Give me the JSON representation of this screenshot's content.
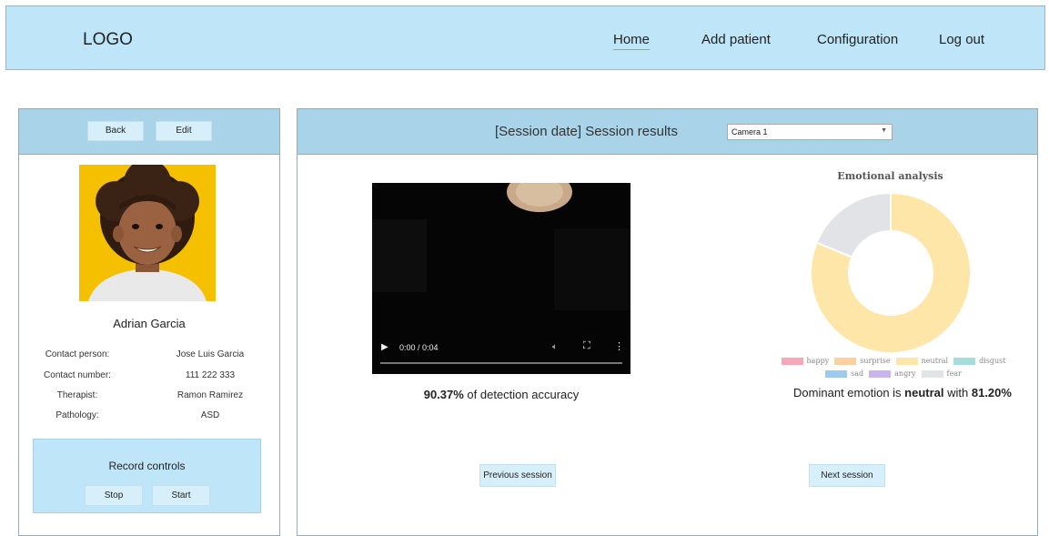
{
  "header": {
    "logo": "LOGO",
    "nav": [
      {
        "label": "Home",
        "active": true
      },
      {
        "label": "Add patient"
      },
      {
        "label": "Configuration"
      },
      {
        "label": "Log out"
      }
    ]
  },
  "patient_panel": {
    "back_label": "Back",
    "edit_label": "Edit",
    "name": "Adrian Garcia",
    "fields": [
      {
        "label": "Contact person:",
        "value": "Jose Luis Garcia"
      },
      {
        "label": "Contact number:",
        "value": "111 222 333"
      },
      {
        "label": "Therapist:",
        "value": "Ramon Ramirez"
      },
      {
        "label": "Pathology:",
        "value": "ASD"
      }
    ],
    "record_controls": {
      "title": "Record controls",
      "stop_label": "Stop",
      "start_label": "Start"
    }
  },
  "session": {
    "title": "[Session date] Session results",
    "camera_selected": "Camera 1",
    "video_time": "0:00 / 0:04",
    "accuracy_value": "90.37%",
    "accuracy_text": " of detection accuracy",
    "dominant_prefix": "Dominant emotion is ",
    "dominant_emotion": "neutral",
    "dominant_mid": " with ",
    "dominant_value": "81.20%",
    "previous_label": "Previous session",
    "next_label": "Next session"
  },
  "chart_data": {
    "type": "pie",
    "title": "Emotional analysis",
    "style": "doughnut",
    "legend_position": "bottom",
    "categories": [
      "happy",
      "surprise",
      "neutral",
      "disgust",
      "sad",
      "angry",
      "fear"
    ],
    "values": [
      0,
      0,
      81.2,
      0,
      0,
      0,
      18.8
    ],
    "colors": [
      "#f7a8b8",
      "#fbcf9f",
      "#fde6a8",
      "#a7dcdc",
      "#9cc9ec",
      "#c9b4f0",
      "#e2e3e6"
    ]
  }
}
